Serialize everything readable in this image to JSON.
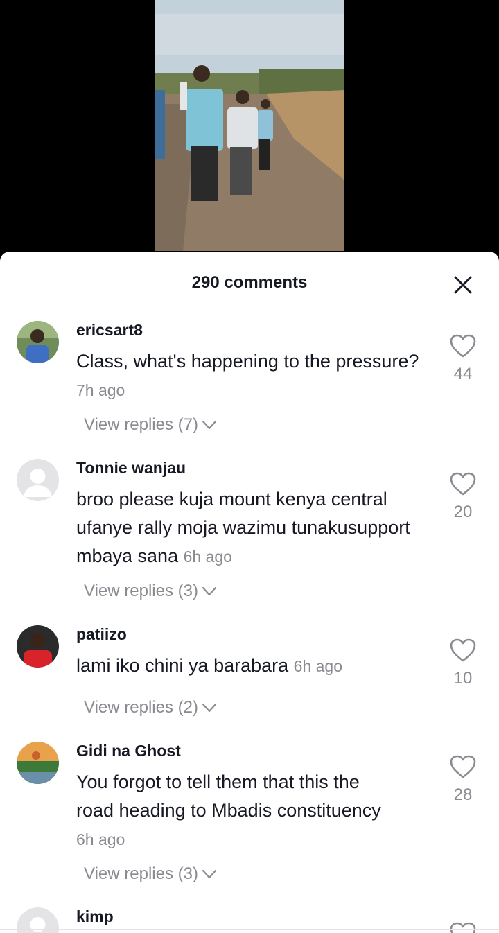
{
  "sheet": {
    "title": "290 comments"
  },
  "comments": [
    {
      "username": "ericsart8",
      "text": "Class, what's happening to the pressure?",
      "time": "7h ago",
      "replies": "View replies (7)",
      "likes": "44"
    },
    {
      "username": "Tonnie wanjau",
      "text": "broo please kuja mount kenya central ufanye rally moja wazimu tunakusupport mbaya sana",
      "time": "6h ago",
      "replies": "View replies (3)",
      "likes": "20"
    },
    {
      "username": "patiizo",
      "text": "lami iko chini ya barabara",
      "time": "6h ago",
      "replies": "View replies (2)",
      "likes": "10"
    },
    {
      "username": "Gidi na Ghost",
      "text": "You forgot to tell them that this the road heading to Mbadis constituency",
      "time": "6h ago",
      "replies": "View replies (3)",
      "likes": "28"
    },
    {
      "username": "kimp"
    }
  ],
  "icons": {
    "close": "close-icon",
    "like": "heart-outline-icon",
    "expand": "chevron-down-icon"
  },
  "colors": {
    "text_primary": "#161823",
    "text_secondary": "#8a8b91"
  }
}
